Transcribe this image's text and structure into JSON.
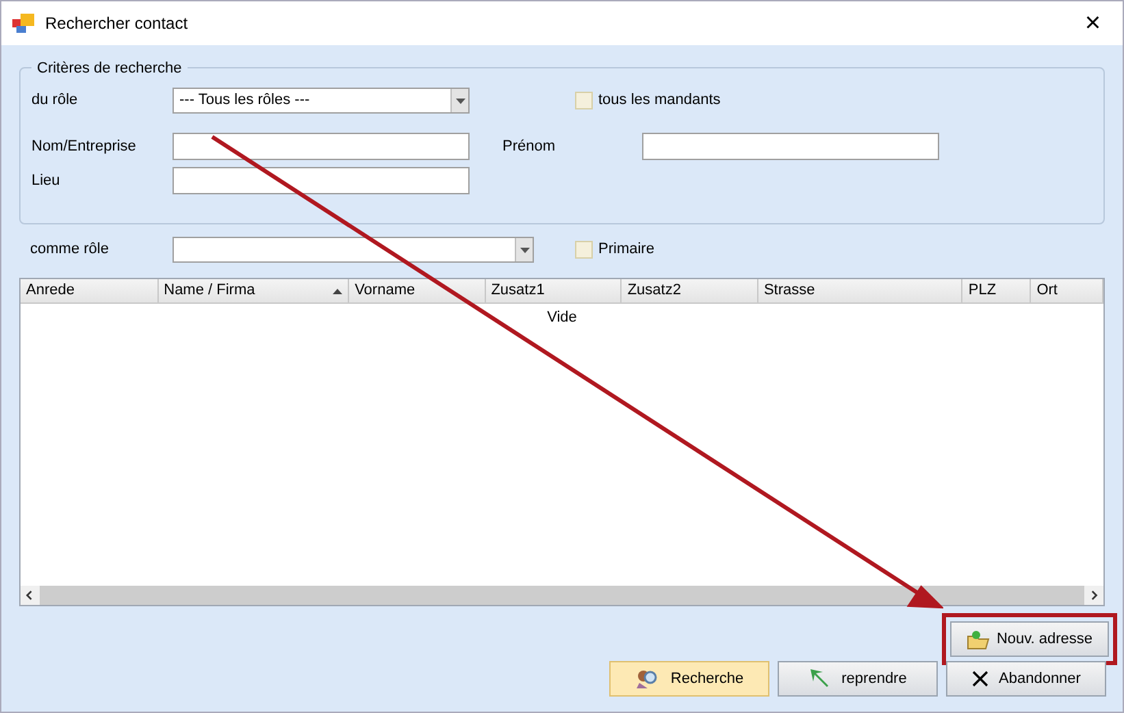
{
  "window": {
    "title": "Rechercher contact",
    "close": "×"
  },
  "criteria": {
    "legend": "Critères de recherche",
    "role_label": "du rôle",
    "role_value": "--- Tous les rôles ---",
    "all_clients": {
      "label": "tous les mandants",
      "checked": false
    },
    "name_label": "Nom/Entreprise",
    "firstname_label": "Prénom",
    "place_label": "Lieu"
  },
  "as_role": {
    "label": "comme rôle",
    "primary": {
      "label": "Primaire",
      "checked": false
    }
  },
  "table": {
    "columns": [
      {
        "label": "Anrede",
        "sorted": false
      },
      {
        "label": "Name / Firma",
        "sorted": true
      },
      {
        "label": "Vorname",
        "sorted": false
      },
      {
        "label": "Zusatz1",
        "sorted": false
      },
      {
        "label": "Zusatz2",
        "sorted": false
      },
      {
        "label": "Strasse",
        "sorted": false
      },
      {
        "label": "PLZ",
        "sorted": false
      },
      {
        "label": "Ort",
        "sorted": false
      }
    ],
    "empty_text": "Vide"
  },
  "new_address_button": {
    "label": "Nouv. adresse",
    "highlighted": true
  },
  "buttons": [
    {
      "kind": "search",
      "label": "Recherche",
      "selected": true
    },
    {
      "kind": "take",
      "label": "reprendre",
      "selected": false
    },
    {
      "kind": "cancel",
      "label": "Abandonner",
      "selected": false
    }
  ]
}
